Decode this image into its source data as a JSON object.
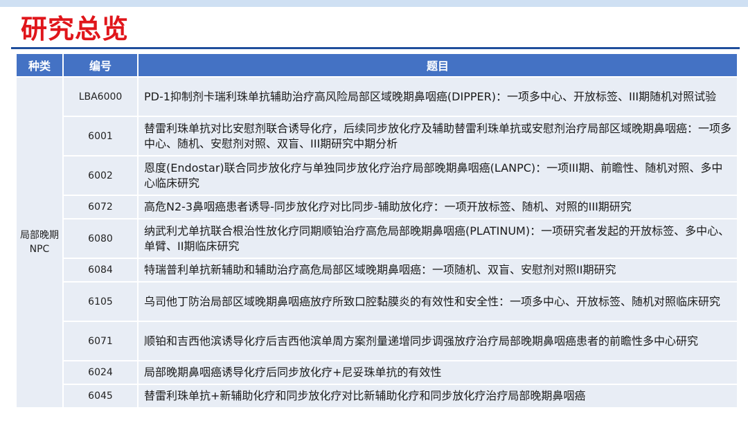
{
  "title": "研究总览",
  "table": {
    "headers": [
      "种类",
      "编号",
      "题目"
    ],
    "category": "局部晚期\nNPC",
    "rows": [
      {
        "id": "LBA6000",
        "title": "PD-1抑制剂卡瑞利珠单抗辅助治疗高风险局部区域晚期鼻咽癌(DIPPER)：一项多中心、开放标签、III期随机对照试验"
      },
      {
        "id": "6001",
        "title": "替雷利珠单抗对比安慰剂联合诱导化疗，后续同步放化疗及辅助替雷利珠单抗或安慰剂治疗局部区域晚期鼻咽癌：一项多中心、随机、安慰剂对照、双盲、III期研究中期分析"
      },
      {
        "id": "6002",
        "title": "恩度(Endostar)联合同步放化疗与单独同步放化疗治疗局部晚期鼻咽癌(LANPC)：一项III期、前瞻性、随机对照、多中心临床研究"
      },
      {
        "id": "6072",
        "title": "高危N2-3鼻咽癌患者诱导-同步放化疗对比同步-辅助放化疗：一项开放标签、随机、对照的III期研究"
      },
      {
        "id": "6080",
        "title": "纳武利尤单抗联合根治性放化疗同期顺铂治疗高危局部晚期鼻咽癌(PLATINUM)：一项研究者发起的开放标签、多中心、单臂、II期临床研究"
      },
      {
        "id": "6084",
        "title": "特瑞普利单抗新辅助和辅助治疗高危局部区域晚期鼻咽癌：一项随机、双盲、安慰剂对照II期研究"
      },
      {
        "id": "6105",
        "title": "乌司他丁防治局部区域晚期鼻咽癌放疗所致口腔黏膜炎的有效性和安全性：一项多中心、开放标签、随机对照临床研究"
      },
      {
        "id": "6071",
        "title": "顺铂和吉西他滨诱导化疗后吉西他滨单周方案剂量递增同步调强放疗治疗局部晚期鼻咽癌患者的前瞻性多中心研究"
      },
      {
        "id": "6024",
        "title": "局部晚期鼻咽癌诱导化疗后同步放化疗+尼妥珠单抗的有效性"
      },
      {
        "id": "6045",
        "title": "替雷利珠单抗+新辅助化疗和同步放化疗对比新辅助化疗和同步放化疗治疗局部晚期鼻咽癌"
      }
    ]
  }
}
